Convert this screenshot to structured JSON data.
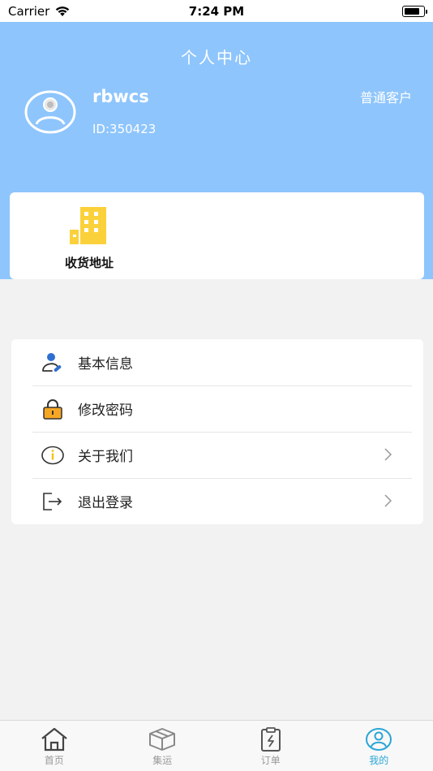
{
  "status_bar": {
    "carrier": "Carrier",
    "time": "7:24 PM"
  },
  "header": {
    "title": "个人中心",
    "username": "rbwcs",
    "user_id": "ID:350423",
    "level": "普通客户",
    "background_color": "#8ec5fc"
  },
  "address": {
    "label": "收货地址",
    "icon": "building-icon"
  },
  "menu": {
    "items": [
      {
        "label": "基本信息",
        "icon": "user-edit-icon",
        "has_chevron": false
      },
      {
        "label": "修改密码",
        "icon": "lock-icon",
        "has_chevron": false
      },
      {
        "label": "关于我们",
        "icon": "info-icon",
        "has_chevron": true
      },
      {
        "label": "退出登录",
        "icon": "logout-icon",
        "has_chevron": true
      }
    ]
  },
  "tab_bar": {
    "active_color": "#2aa6d6",
    "tabs": [
      {
        "label": "首页",
        "icon": "home-icon",
        "active": false
      },
      {
        "label": "集运",
        "icon": "box-icon",
        "active": false
      },
      {
        "label": "订单",
        "icon": "clipboard-icon",
        "active": false
      },
      {
        "label": "我的",
        "icon": "profile-icon",
        "active": true
      }
    ]
  }
}
